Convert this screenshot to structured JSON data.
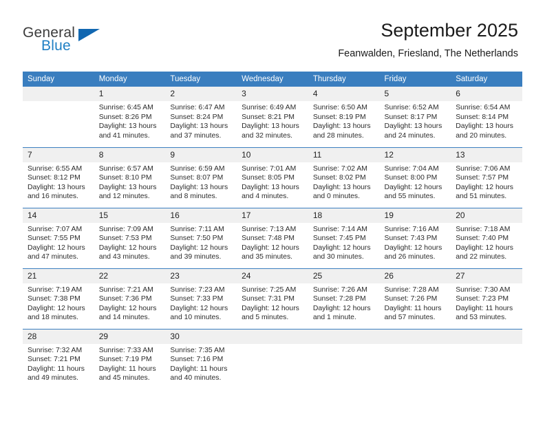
{
  "brand": {
    "name_part1": "General",
    "name_part2": "Blue",
    "triangle_icon": "triangle-logo-icon",
    "color_primary": "#1167b1",
    "color_secondary": "#1f7fc4"
  },
  "header": {
    "title": "September 2025",
    "subtitle": "Feanwalden, Friesland, The Netherlands"
  },
  "theme": {
    "header_row_bg": "#3a7ebf",
    "daynum_bg": "#f0f0f0",
    "divider": "#3a7ebf",
    "text": "#2b2b2b"
  },
  "calendar": {
    "weekday_headers": [
      "Sunday",
      "Monday",
      "Tuesday",
      "Wednesday",
      "Thursday",
      "Friday",
      "Saturday"
    ],
    "weeks": [
      [
        {
          "day": "",
          "sunrise": "",
          "sunset": "",
          "daylight_line1": "",
          "daylight_line2": "",
          "empty": true
        },
        {
          "day": "1",
          "sunrise": "Sunrise: 6:45 AM",
          "sunset": "Sunset: 8:26 PM",
          "daylight_line1": "Daylight: 13 hours",
          "daylight_line2": "and 41 minutes."
        },
        {
          "day": "2",
          "sunrise": "Sunrise: 6:47 AM",
          "sunset": "Sunset: 8:24 PM",
          "daylight_line1": "Daylight: 13 hours",
          "daylight_line2": "and 37 minutes."
        },
        {
          "day": "3",
          "sunrise": "Sunrise: 6:49 AM",
          "sunset": "Sunset: 8:21 PM",
          "daylight_line1": "Daylight: 13 hours",
          "daylight_line2": "and 32 minutes."
        },
        {
          "day": "4",
          "sunrise": "Sunrise: 6:50 AM",
          "sunset": "Sunset: 8:19 PM",
          "daylight_line1": "Daylight: 13 hours",
          "daylight_line2": "and 28 minutes."
        },
        {
          "day": "5",
          "sunrise": "Sunrise: 6:52 AM",
          "sunset": "Sunset: 8:17 PM",
          "daylight_line1": "Daylight: 13 hours",
          "daylight_line2": "and 24 minutes."
        },
        {
          "day": "6",
          "sunrise": "Sunrise: 6:54 AM",
          "sunset": "Sunset: 8:14 PM",
          "daylight_line1": "Daylight: 13 hours",
          "daylight_line2": "and 20 minutes."
        }
      ],
      [
        {
          "day": "7",
          "sunrise": "Sunrise: 6:55 AM",
          "sunset": "Sunset: 8:12 PM",
          "daylight_line1": "Daylight: 13 hours",
          "daylight_line2": "and 16 minutes."
        },
        {
          "day": "8",
          "sunrise": "Sunrise: 6:57 AM",
          "sunset": "Sunset: 8:10 PM",
          "daylight_line1": "Daylight: 13 hours",
          "daylight_line2": "and 12 minutes."
        },
        {
          "day": "9",
          "sunrise": "Sunrise: 6:59 AM",
          "sunset": "Sunset: 8:07 PM",
          "daylight_line1": "Daylight: 13 hours",
          "daylight_line2": "and 8 minutes."
        },
        {
          "day": "10",
          "sunrise": "Sunrise: 7:01 AM",
          "sunset": "Sunset: 8:05 PM",
          "daylight_line1": "Daylight: 13 hours",
          "daylight_line2": "and 4 minutes."
        },
        {
          "day": "11",
          "sunrise": "Sunrise: 7:02 AM",
          "sunset": "Sunset: 8:02 PM",
          "daylight_line1": "Daylight: 13 hours",
          "daylight_line2": "and 0 minutes."
        },
        {
          "day": "12",
          "sunrise": "Sunrise: 7:04 AM",
          "sunset": "Sunset: 8:00 PM",
          "daylight_line1": "Daylight: 12 hours",
          "daylight_line2": "and 55 minutes."
        },
        {
          "day": "13",
          "sunrise": "Sunrise: 7:06 AM",
          "sunset": "Sunset: 7:57 PM",
          "daylight_line1": "Daylight: 12 hours",
          "daylight_line2": "and 51 minutes."
        }
      ],
      [
        {
          "day": "14",
          "sunrise": "Sunrise: 7:07 AM",
          "sunset": "Sunset: 7:55 PM",
          "daylight_line1": "Daylight: 12 hours",
          "daylight_line2": "and 47 minutes."
        },
        {
          "day": "15",
          "sunrise": "Sunrise: 7:09 AM",
          "sunset": "Sunset: 7:53 PM",
          "daylight_line1": "Daylight: 12 hours",
          "daylight_line2": "and 43 minutes."
        },
        {
          "day": "16",
          "sunrise": "Sunrise: 7:11 AM",
          "sunset": "Sunset: 7:50 PM",
          "daylight_line1": "Daylight: 12 hours",
          "daylight_line2": "and 39 minutes."
        },
        {
          "day": "17",
          "sunrise": "Sunrise: 7:13 AM",
          "sunset": "Sunset: 7:48 PM",
          "daylight_line1": "Daylight: 12 hours",
          "daylight_line2": "and 35 minutes."
        },
        {
          "day": "18",
          "sunrise": "Sunrise: 7:14 AM",
          "sunset": "Sunset: 7:45 PM",
          "daylight_line1": "Daylight: 12 hours",
          "daylight_line2": "and 30 minutes."
        },
        {
          "day": "19",
          "sunrise": "Sunrise: 7:16 AM",
          "sunset": "Sunset: 7:43 PM",
          "daylight_line1": "Daylight: 12 hours",
          "daylight_line2": "and 26 minutes."
        },
        {
          "day": "20",
          "sunrise": "Sunrise: 7:18 AM",
          "sunset": "Sunset: 7:40 PM",
          "daylight_line1": "Daylight: 12 hours",
          "daylight_line2": "and 22 minutes."
        }
      ],
      [
        {
          "day": "21",
          "sunrise": "Sunrise: 7:19 AM",
          "sunset": "Sunset: 7:38 PM",
          "daylight_line1": "Daylight: 12 hours",
          "daylight_line2": "and 18 minutes."
        },
        {
          "day": "22",
          "sunrise": "Sunrise: 7:21 AM",
          "sunset": "Sunset: 7:36 PM",
          "daylight_line1": "Daylight: 12 hours",
          "daylight_line2": "and 14 minutes."
        },
        {
          "day": "23",
          "sunrise": "Sunrise: 7:23 AM",
          "sunset": "Sunset: 7:33 PM",
          "daylight_line1": "Daylight: 12 hours",
          "daylight_line2": "and 10 minutes."
        },
        {
          "day": "24",
          "sunrise": "Sunrise: 7:25 AM",
          "sunset": "Sunset: 7:31 PM",
          "daylight_line1": "Daylight: 12 hours",
          "daylight_line2": "and 5 minutes."
        },
        {
          "day": "25",
          "sunrise": "Sunrise: 7:26 AM",
          "sunset": "Sunset: 7:28 PM",
          "daylight_line1": "Daylight: 12 hours",
          "daylight_line2": "and 1 minute."
        },
        {
          "day": "26",
          "sunrise": "Sunrise: 7:28 AM",
          "sunset": "Sunset: 7:26 PM",
          "daylight_line1": "Daylight: 11 hours",
          "daylight_line2": "and 57 minutes."
        },
        {
          "day": "27",
          "sunrise": "Sunrise: 7:30 AM",
          "sunset": "Sunset: 7:23 PM",
          "daylight_line1": "Daylight: 11 hours",
          "daylight_line2": "and 53 minutes."
        }
      ],
      [
        {
          "day": "28",
          "sunrise": "Sunrise: 7:32 AM",
          "sunset": "Sunset: 7:21 PM",
          "daylight_line1": "Daylight: 11 hours",
          "daylight_line2": "and 49 minutes."
        },
        {
          "day": "29",
          "sunrise": "Sunrise: 7:33 AM",
          "sunset": "Sunset: 7:19 PM",
          "daylight_line1": "Daylight: 11 hours",
          "daylight_line2": "and 45 minutes."
        },
        {
          "day": "30",
          "sunrise": "Sunrise: 7:35 AM",
          "sunset": "Sunset: 7:16 PM",
          "daylight_line1": "Daylight: 11 hours",
          "daylight_line2": "and 40 minutes."
        },
        {
          "day": "",
          "sunrise": "",
          "sunset": "",
          "daylight_line1": "",
          "daylight_line2": "",
          "empty": true
        },
        {
          "day": "",
          "sunrise": "",
          "sunset": "",
          "daylight_line1": "",
          "daylight_line2": "",
          "empty": true
        },
        {
          "day": "",
          "sunrise": "",
          "sunset": "",
          "daylight_line1": "",
          "daylight_line2": "",
          "empty": true
        },
        {
          "day": "",
          "sunrise": "",
          "sunset": "",
          "daylight_line1": "",
          "daylight_line2": "",
          "empty": true
        }
      ]
    ]
  }
}
